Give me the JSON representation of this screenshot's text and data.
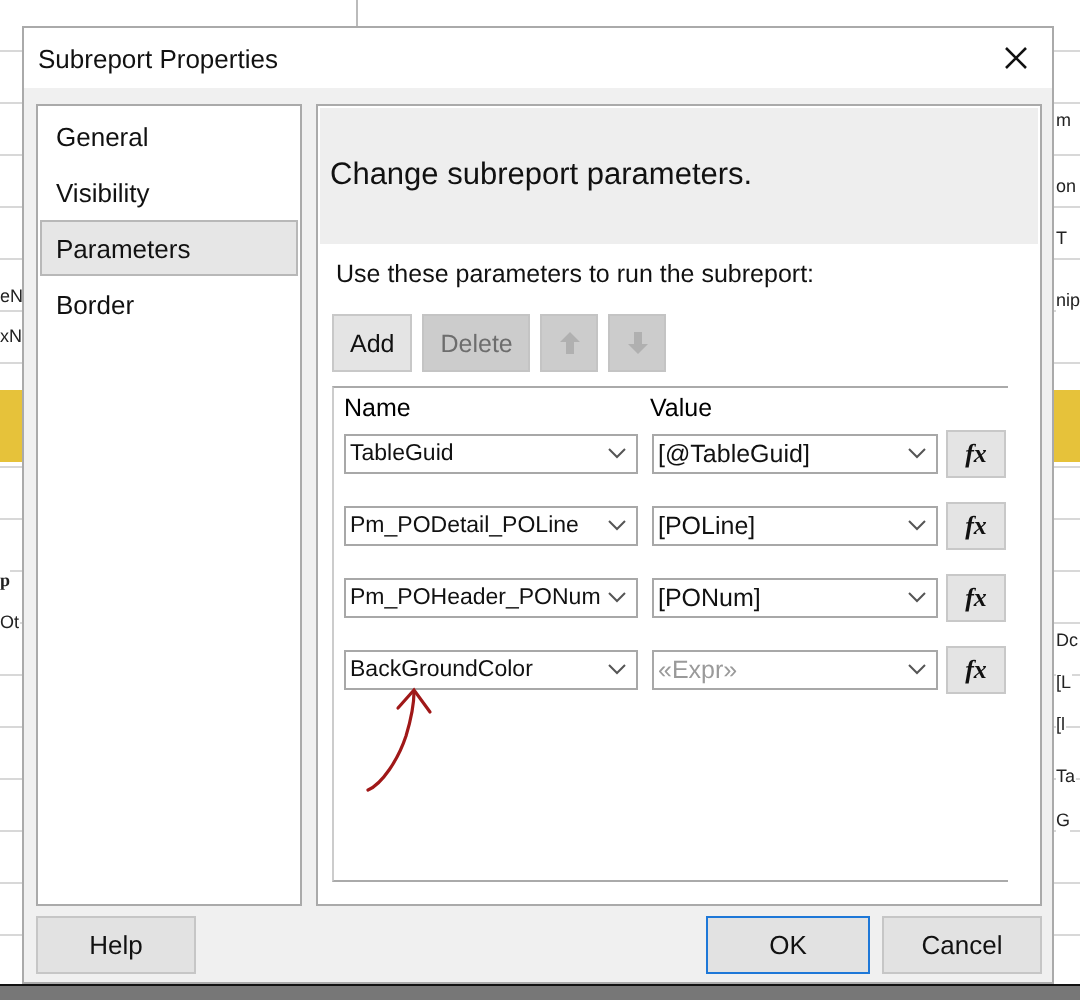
{
  "background": {
    "left_fragments": [
      "eN",
      "xN",
      "p",
      "Ot"
    ],
    "right_fragments": [
      "m",
      "on",
      "T",
      "nip",
      "Dc",
      "[L",
      "[l",
      "Ta",
      "G"
    ]
  },
  "window": {
    "title": "Subreport Properties"
  },
  "sidebar": {
    "items": [
      {
        "label": "General",
        "selected": false
      },
      {
        "label": "Visibility",
        "selected": false
      },
      {
        "label": "Parameters",
        "selected": true
      },
      {
        "label": "Border",
        "selected": false
      }
    ]
  },
  "header": "Change subreport parameters.",
  "instruction": "Use these parameters to run the subreport:",
  "toolbar": [
    {
      "kind": "text",
      "label": "Add",
      "disabled": false
    },
    {
      "kind": "text",
      "label": "Delete",
      "disabled": true
    },
    {
      "kind": "up",
      "disabled": true
    },
    {
      "kind": "down",
      "disabled": true
    }
  ],
  "table": {
    "columns": [
      "Name",
      "Value"
    ],
    "rows": [
      {
        "name": "TableGuid",
        "value": "[@TableGuid]",
        "expr_button": "fx"
      },
      {
        "name": "Pm_PODetail_POLine",
        "value": "[POLine]",
        "expr_button": "fx"
      },
      {
        "name": "Pm_POHeader_PONum",
        "value": "[PONum]",
        "expr_button": "fx"
      },
      {
        "name": "BackGroundColor",
        "placeholder": "«Expr»",
        "expr_button": "fx"
      }
    ]
  },
  "buttons": [
    {
      "label": "Help",
      "default": false
    },
    {
      "label": "OK",
      "default": true
    },
    {
      "label": "Cancel",
      "default": false
    }
  ]
}
